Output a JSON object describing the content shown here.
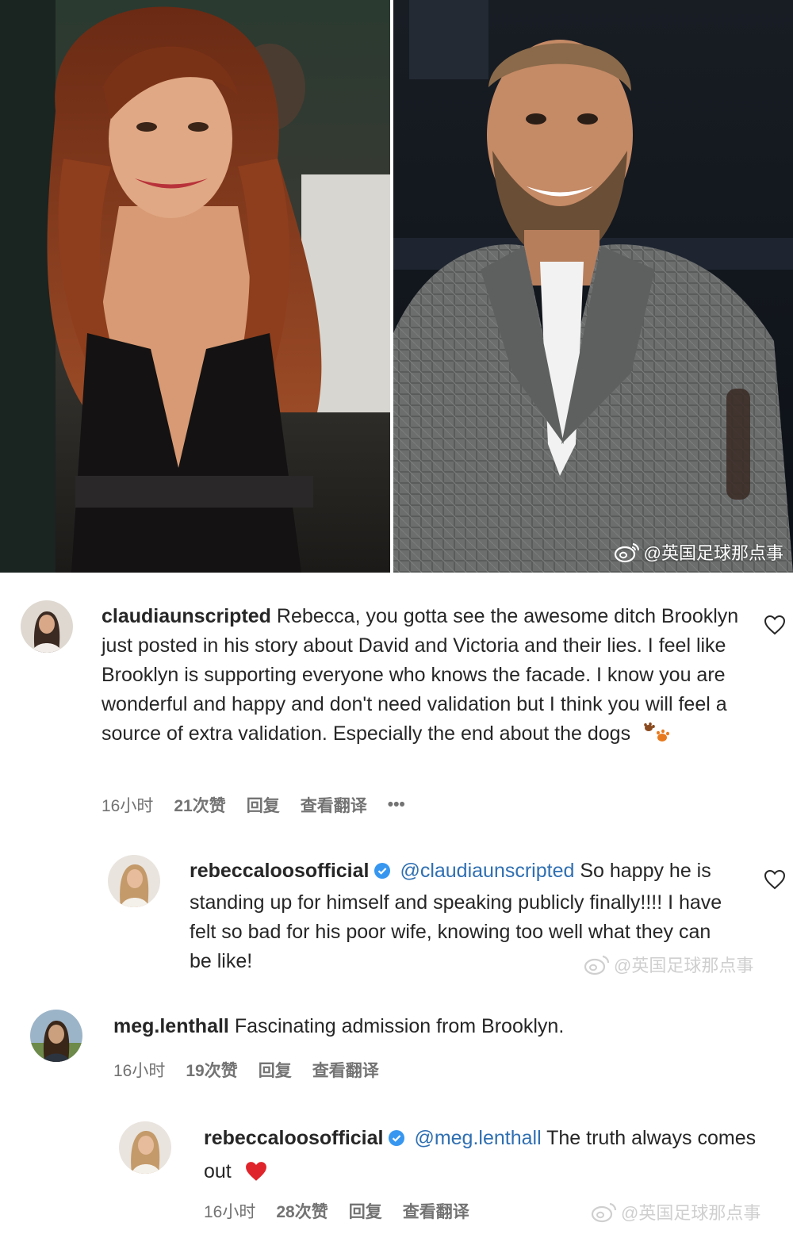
{
  "watermark": {
    "text": "@英国足球那点事"
  },
  "icons": {
    "heart": "heart-icon",
    "verified": "verified-badge-icon",
    "more": "more-options-icon",
    "weibo": "weibo-logo-icon"
  },
  "colors": {
    "mention": "#2f6fb2",
    "verified": "#3797f0",
    "meta": "#737373",
    "text": "#262626",
    "heart_emoji": "#e0242b"
  },
  "comments": [
    {
      "username": "claudiaunscripted",
      "text": "Rebecca, you gotta see the awesome ditch Brooklyn just posted in his story about David and Victoria and their lies. I feel like Brooklyn is supporting everyone who knows the facade. I know you are wonderful and happy and don't need validation but I think you will feel a source of extra validation. Especially the end about the dogs",
      "emoji": "paw-prints",
      "time": "16小时",
      "likes": "21次赞",
      "reply": "回复",
      "translate": "查看翻译",
      "more": "•••"
    },
    {
      "username": "rebeccaloosofficial",
      "verified": true,
      "mention": "@claudiaunscripted",
      "text": "So happy he is standing up for himself and speaking publicly finally!!!! I have felt so bad for his poor wife, knowing too well what they can be like!"
    },
    {
      "username": "meg.lenthall",
      "text": "Fascinating admission from Brooklyn.",
      "time": "16小时",
      "likes": "19次赞",
      "reply": "回复",
      "translate": "查看翻译"
    },
    {
      "username": "rebeccaloosofficial",
      "verified": true,
      "mention": "@meg.lenthall",
      "text": "The truth always comes out",
      "emoji": "red-heart",
      "time": "16小时",
      "likes": "28次赞",
      "reply": "回复",
      "translate": "查看翻译"
    }
  ]
}
